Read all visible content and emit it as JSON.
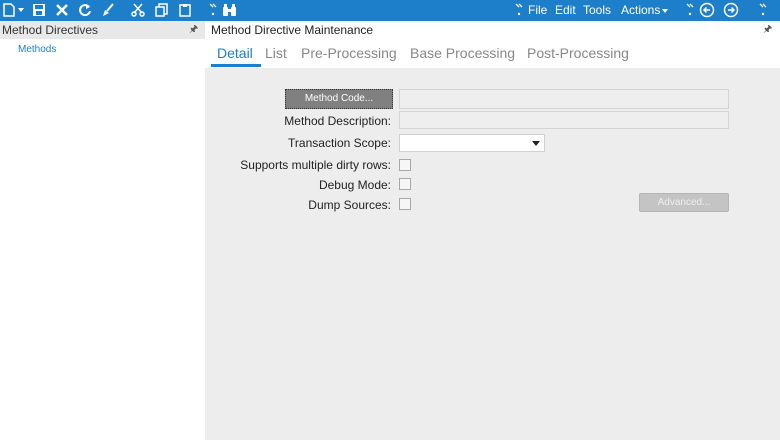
{
  "toolbar": {
    "icons": [
      "new-icon",
      "save-icon",
      "delete-icon",
      "refresh-icon",
      "clear-icon",
      "cut-icon",
      "copy-icon",
      "paste-icon",
      "search-icon"
    ],
    "menu": {
      "file": "File",
      "edit": "Edit",
      "tools": "Tools",
      "actions": "Actions"
    },
    "nav_icons": [
      "back-icon",
      "forward-icon"
    ]
  },
  "left_panel": {
    "title": "Method Directives",
    "items": [
      {
        "label": "Methods"
      }
    ]
  },
  "right_panel": {
    "title": "Method Directive Maintenance",
    "tabs": [
      {
        "label": "Detail",
        "active": true
      },
      {
        "label": "List",
        "active": false
      },
      {
        "label": "Pre-Processing",
        "active": false
      },
      {
        "label": "Base Processing",
        "active": false
      },
      {
        "label": "Post-Processing",
        "active": false
      }
    ],
    "form": {
      "method_code_button": "Method Code...",
      "method_code_value": "",
      "method_description_label": "Method Description:",
      "method_description_value": "",
      "transaction_scope_label": "Transaction Scope:",
      "transaction_scope_value": "",
      "supports_multiple_label": "Supports multiple dirty rows:",
      "supports_multiple_checked": false,
      "debug_mode_label": "Debug Mode:",
      "debug_mode_checked": false,
      "dump_sources_label": "Dump Sources:",
      "dump_sources_checked": false,
      "advanced_button": "Advanced..."
    }
  },
  "colors": {
    "accent": "#1d7fc9",
    "form_background": "#ededed"
  }
}
